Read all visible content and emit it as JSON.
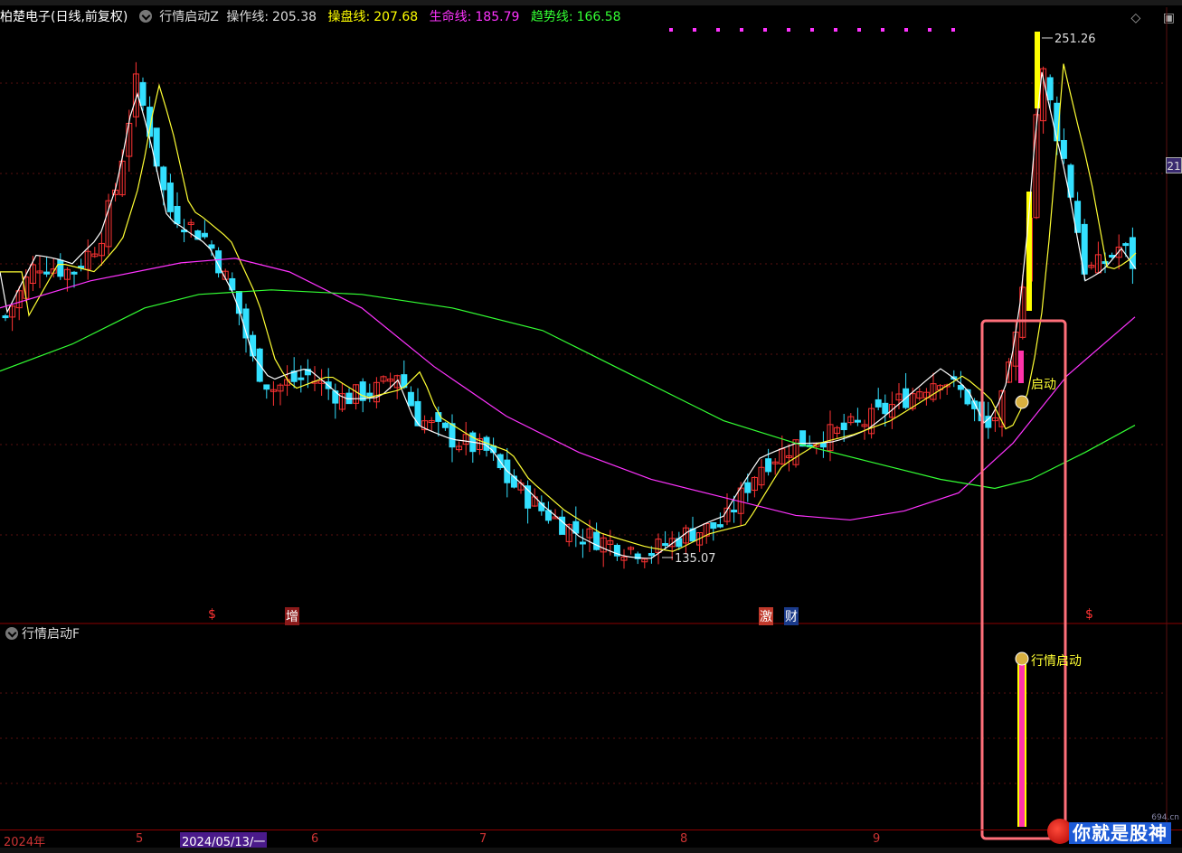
{
  "header": {
    "stock_name": "柏楚电子(日线,前复权)",
    "indicator_name": "行情启动Z",
    "lines": [
      {
        "label": "操作线:",
        "value": "205.38",
        "color": "#dddddd"
      },
      {
        "label": "操盘线:",
        "value": "207.68",
        "color": "#ffff00"
      },
      {
        "label": "生命线:",
        "value": "185.79",
        "color": "#ff33ff"
      },
      {
        "label": "趋势线:",
        "value": "166.58",
        "color": "#33ff33"
      }
    ]
  },
  "sub_panel": {
    "title": "行情启动F",
    "signal_label": "行情启动"
  },
  "annotations": {
    "high_label": "251.26",
    "low_label": "135.07",
    "start_label": "启动",
    "right_price_tag": "21"
  },
  "markers": [
    {
      "text": "$",
      "color": "#ff3333"
    },
    {
      "text": "增",
      "color": "#ffffff",
      "bg": "#8b1a1a"
    },
    {
      "text": "激",
      "color": "#ffffff",
      "bg": "#c0392b"
    },
    {
      "text": "财",
      "color": "#ffffff",
      "bg": "#1a3a8a"
    },
    {
      "text": "$",
      "color": "#ff3333"
    }
  ],
  "xaxis": {
    "labels": [
      "2024年",
      "5",
      "2024/05/13/一",
      "6",
      "7",
      "8",
      "9"
    ]
  },
  "icons": {
    "diamond": "diamond-icon",
    "window": "window-icon"
  },
  "watermark": {
    "text": "你就是股神",
    "site": "694.cn"
  },
  "chart_data": {
    "type": "candlestick",
    "high": 251.26,
    "low": 135.07,
    "highlight_box": true,
    "colors": {
      "up": "#ff3333",
      "down": "#33e0ff",
      "ma_fast": "#ffffff",
      "ma_mid": "#ffff33",
      "ma_slow": "#ff33ff",
      "ma_long": "#33ff33"
    }
  }
}
